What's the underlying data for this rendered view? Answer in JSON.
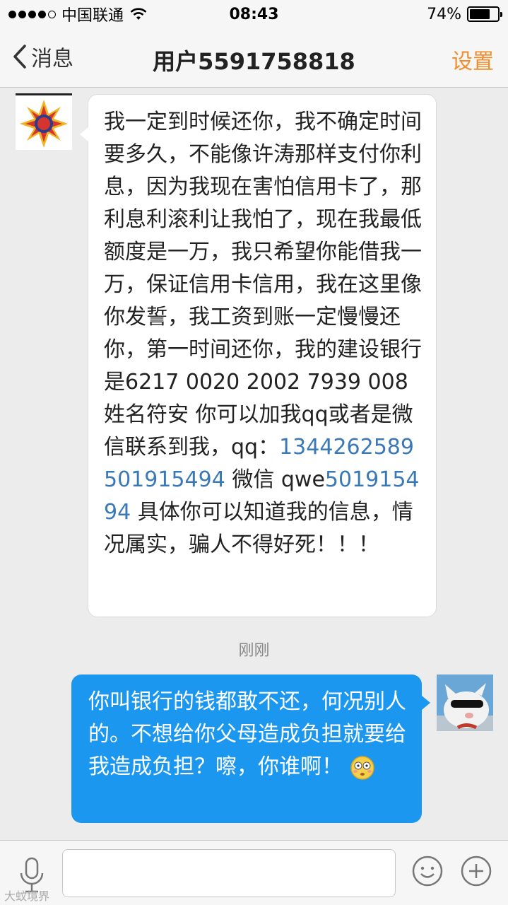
{
  "status_bar": {
    "carrier": "中国联通",
    "time": "08:43",
    "battery_percent": "74%",
    "battery_level": 0.74,
    "signal_bars": 4
  },
  "nav": {
    "back_label": "消息",
    "title": "用户5591758818",
    "settings_label": "设置"
  },
  "messages": {
    "incoming": {
      "text_before_link": "我一定到时候还你，我不确定时间要多久，不能像许涛那样支付你利息，因为我现在害怕信用卡了，那利息利滚利让我怕了，现在我最低额度是一万，我只希望你能借我一万，保证信用卡信用，我在这里像你发誓，我工资到账一定慢慢还你，第一时间还你，我的建设银行是6217 0020 2002 7939 008 姓名符安 你可以加我qq或者是微信联系到我，qq：",
      "link_1": "1344262589",
      "space_1": " ",
      "link_2": "501915494",
      "middle_text": " 微信 qwe",
      "link_3": "501915494",
      "text_after_link": " 具体你可以知道我的信息，情况属实，骗人不得好死！！！"
    },
    "timestamp": "刚刚",
    "outgoing": {
      "text": "你叫银行的钱都敢不还，何况别人的。不想给你父母造成负担就要给我造成负担？嚓，你谁啊！"
    }
  },
  "input_bar": {
    "placeholder": ""
  },
  "watermark": "大蚊境界",
  "colors": {
    "accent_orange": "#f18e2b",
    "outgoing_bubble": "#1c97f0",
    "link_blue": "#3a79b8"
  }
}
